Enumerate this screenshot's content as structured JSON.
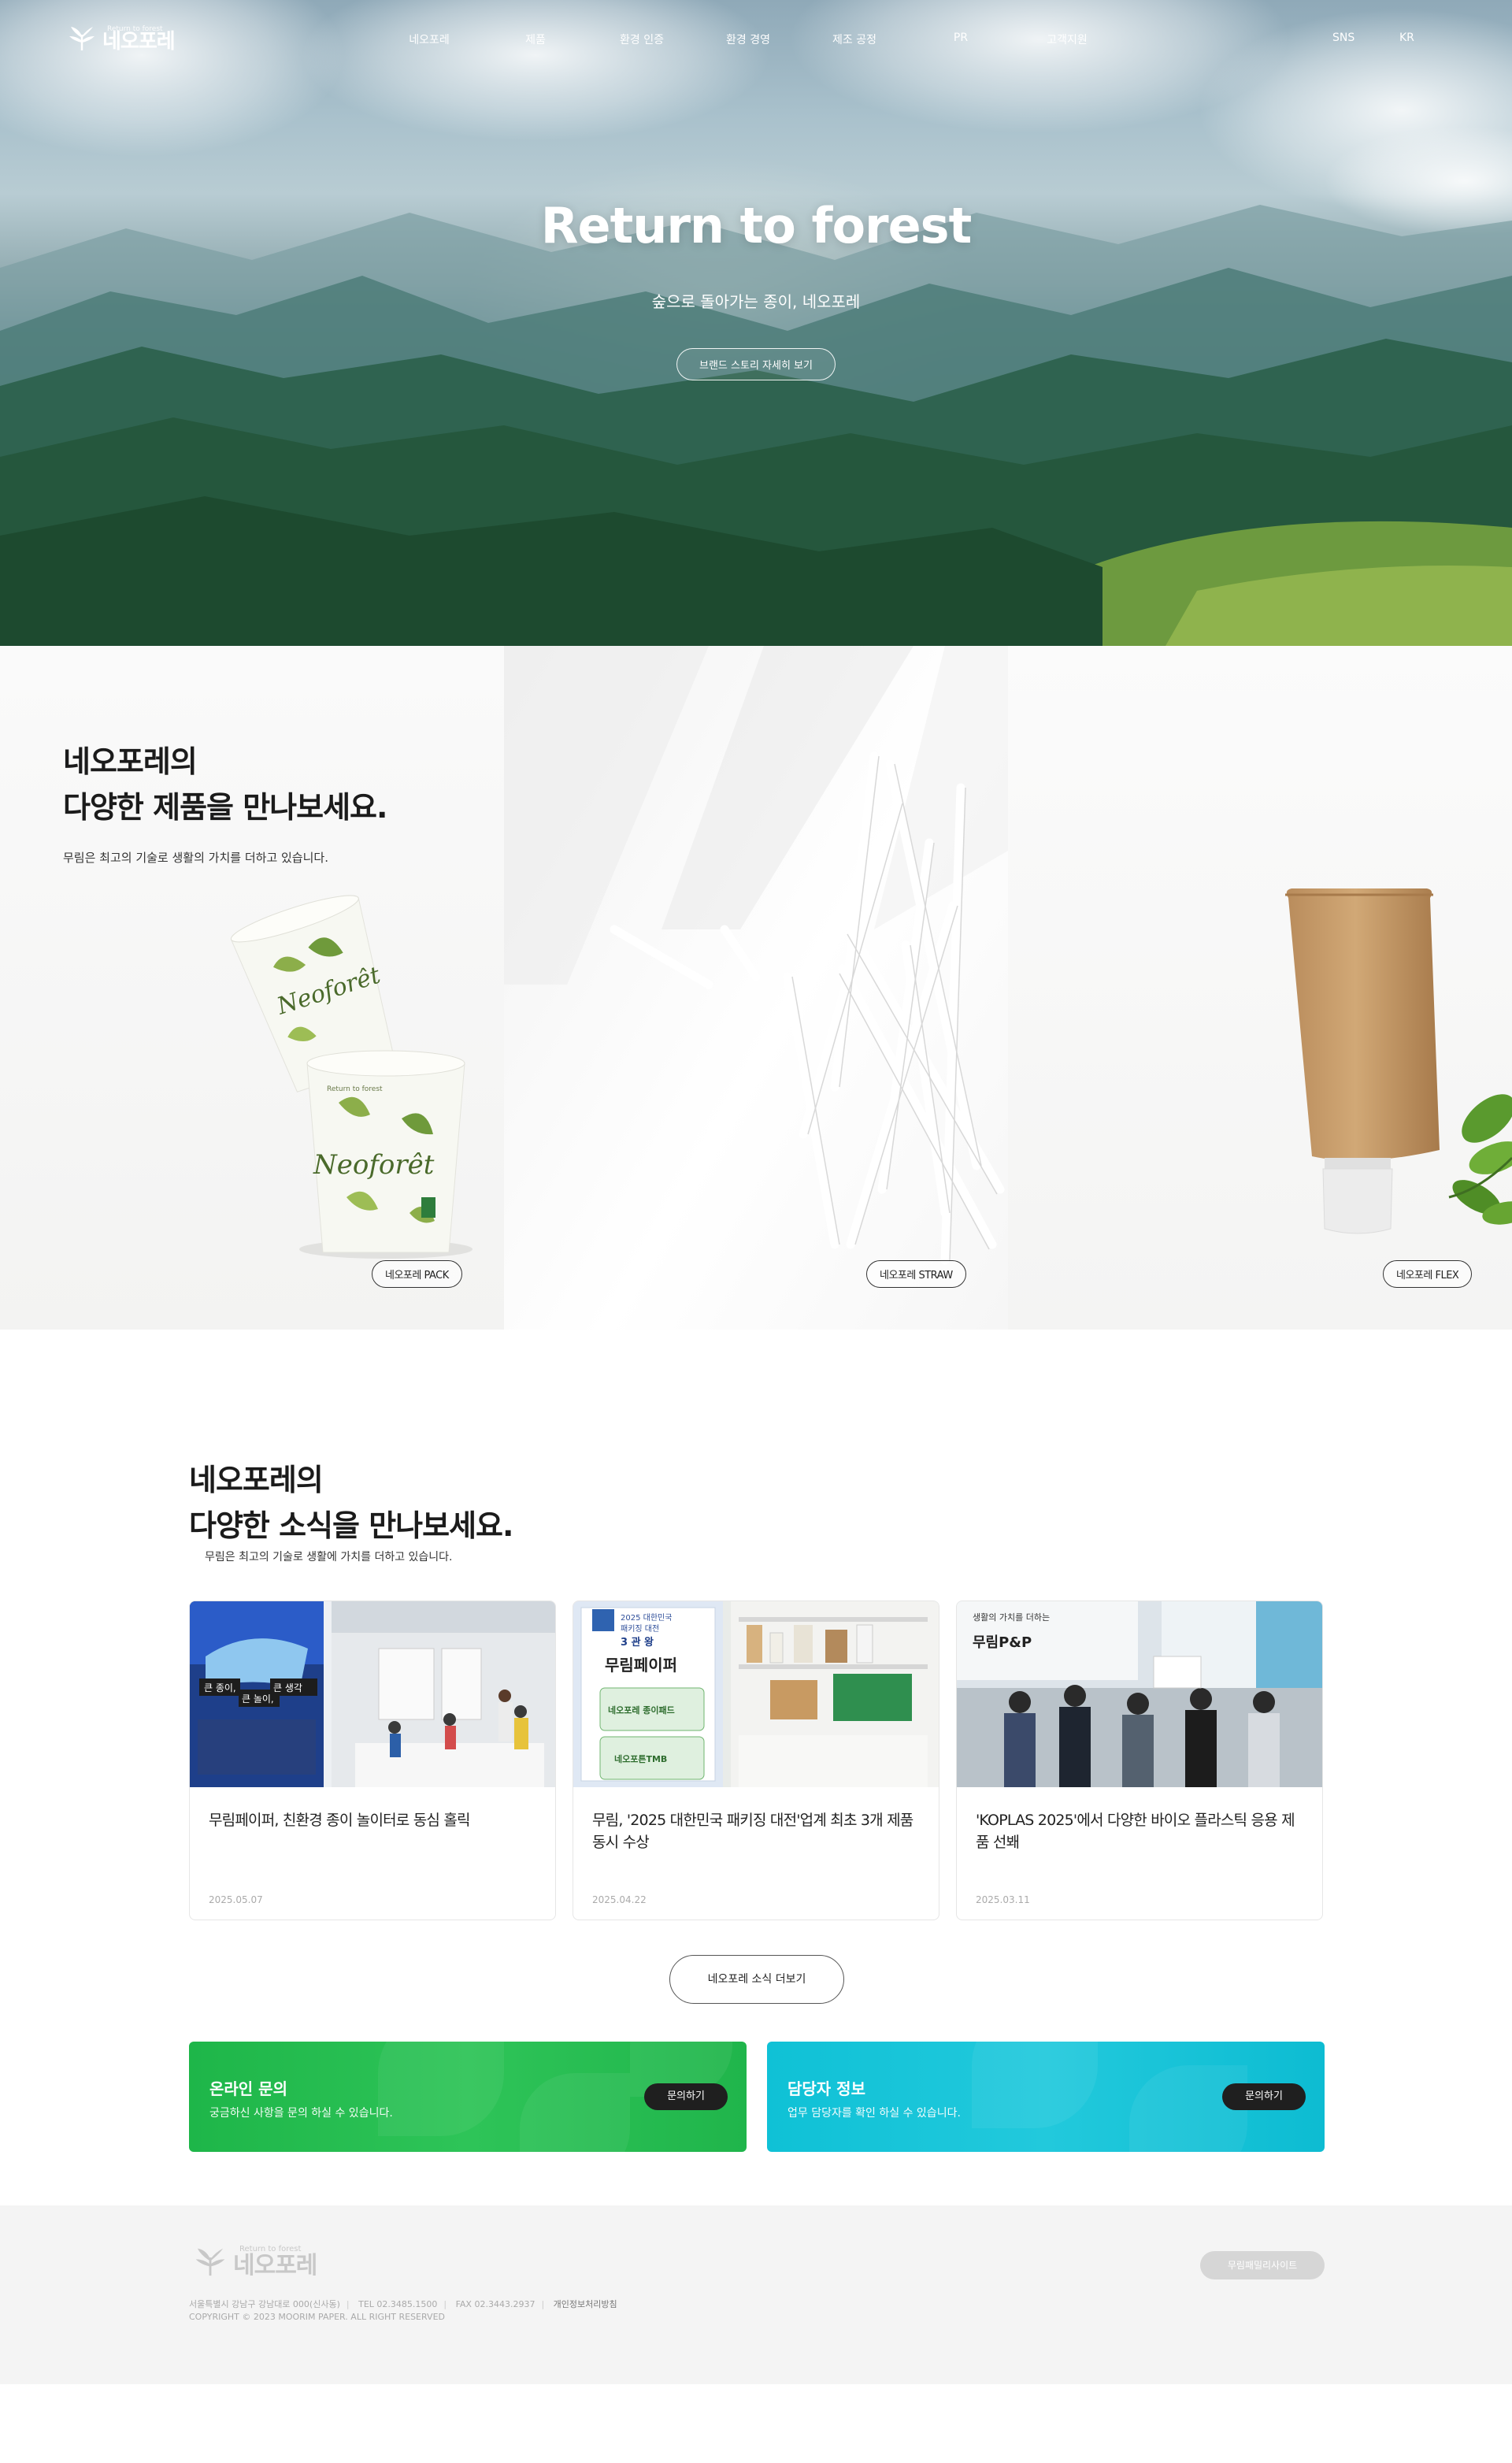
{
  "header": {
    "logo_name": "네오포레",
    "logo_tag": "Return to forest",
    "nav": [
      "네오포레",
      "제품",
      "환경 인증",
      "환경 경영",
      "제조 공정",
      "PR",
      "고객지원"
    ],
    "sns": "SNS",
    "lang": "KR"
  },
  "hero": {
    "title": "Return to forest",
    "subtitle": "숲으로 돌아가는 종이, 네오포레",
    "button": "브랜드 스토리 자세히 보기"
  },
  "products": {
    "title_line1": "네오포레의",
    "title_line2": "다양한 제품을 만나보세요.",
    "desc": "무림은 최고의 기술로 생활의 가치를 더하고 있습니다.",
    "items": [
      {
        "label": "네오포레 PACK",
        "cup_text": "Neoforêt",
        "cup_tag": "Return to forest"
      },
      {
        "label": "네오포레 STRAW"
      },
      {
        "label": "네오포레 FLEX"
      }
    ]
  },
  "news": {
    "title_line1": "네오포레의",
    "title_line2": "다양한 소식을 만나보세요.",
    "desc": "무림은 최고의 기술로 생활에 가치를 더하고 있습니다.",
    "cards": [
      {
        "title": "무림페이퍼, 친환경 종이 놀이터로 동심 홀릭",
        "date": "2025.05.07",
        "thumb_text": [
          "큰 종이,",
          "큰 놀이,",
          "큰 생각"
        ]
      },
      {
        "title": "무림, '2025 대한민국 패키징 대전'업계 최초 3개 제품 동시 수상",
        "date": "2025.04.22",
        "thumb_text": [
          "2025 대한민국",
          "패키징 대전",
          "3 관 왕",
          "무림페이퍼",
          "네오포레 종이패드",
          "네오포튼TMB"
        ]
      },
      {
        "title": "'KOPLAS 2025'에서 다양한 바이오 플라스틱 응용 제품 선봬",
        "date": "2025.03.11",
        "thumb_text": [
          "생활의 가치를 더하는",
          "무림P&P"
        ]
      }
    ],
    "more_button": "네오포레 소식 더보기"
  },
  "banners": [
    {
      "title": "온라인 문의",
      "sub": "궁금하신 사항을 문의 하실 수 있습니다.",
      "button": "문의하기",
      "color": "#22bb4f"
    },
    {
      "title": "담당자 정보",
      "sub": "업무 담당자를 확인 하실 수 있습니다.",
      "button": "문의하기",
      "color": "#14c3d8"
    }
  ],
  "footer": {
    "logo_name": "네오포레",
    "logo_tag": "Return to forest",
    "address": "서울특별시 강남구 강남대로 000(신사동)",
    "tel": "TEL 02.3485.1500",
    "fax": "FAX 02.3443.2937",
    "privacy": "개인정보처리방침",
    "copyright": "COPYRIGHT © 2023 MOORIM PAPER. ALL RIGHT RESERVED",
    "family_site": "무림패밀리사이트"
  }
}
